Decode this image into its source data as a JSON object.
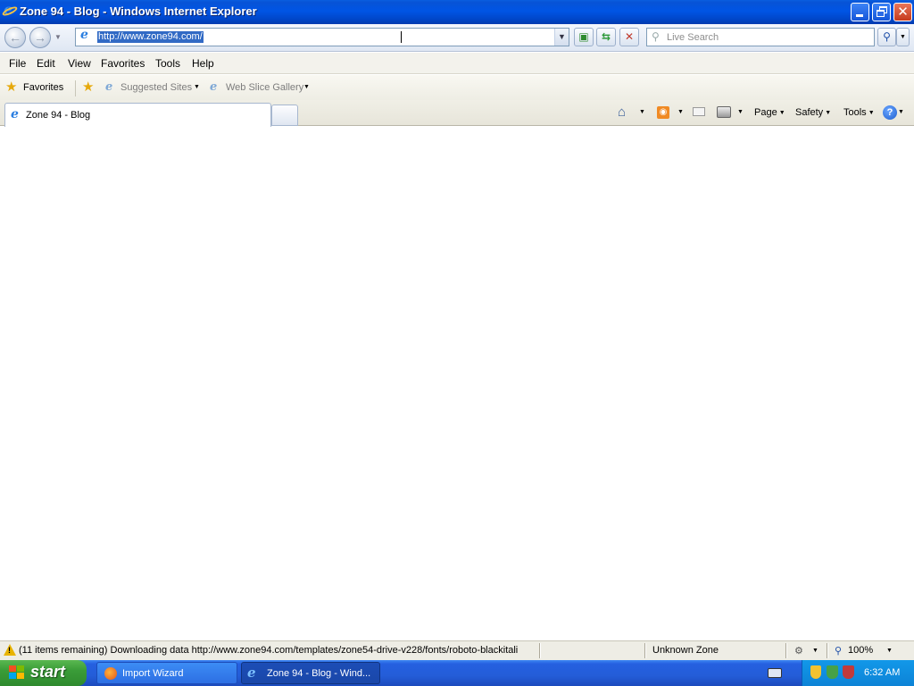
{
  "window": {
    "title": "Zone 94 - Blog - Windows Internet Explorer"
  },
  "address": {
    "url": "http://www.zone94.com/"
  },
  "search": {
    "placeholder": "Live Search"
  },
  "menu": [
    "File",
    "Edit",
    "View",
    "Favorites",
    "Tools",
    "Help"
  ],
  "favorites_bar": {
    "favorites_label": "Favorites",
    "suggested_sites": "Suggested Sites",
    "web_slice_gallery": "Web Slice Gallery"
  },
  "tabs": {
    "active_label": "Zone 94 - Blog"
  },
  "command_bar": {
    "page": "Page",
    "safety": "Safety",
    "tools": "Tools"
  },
  "status": {
    "message": "(11 items remaining) Downloading data http://www.zone94.com/templates/zone54-drive-v228/fonts/roboto-blackitali",
    "zone": "Unknown Zone",
    "zoom": "100%"
  },
  "taskbar": {
    "start_label": "start",
    "tasks": [
      {
        "label": "Import Wizard"
      },
      {
        "label": "Zone 94 - Blog - Wind..."
      }
    ],
    "clock": "6:32 AM"
  },
  "colors": {
    "titlebar": "#0055e5",
    "url_selection": "#316ac5",
    "taskbar": "#245dd8",
    "start_button": "#3a9c38",
    "tray": "#0d83d6"
  }
}
